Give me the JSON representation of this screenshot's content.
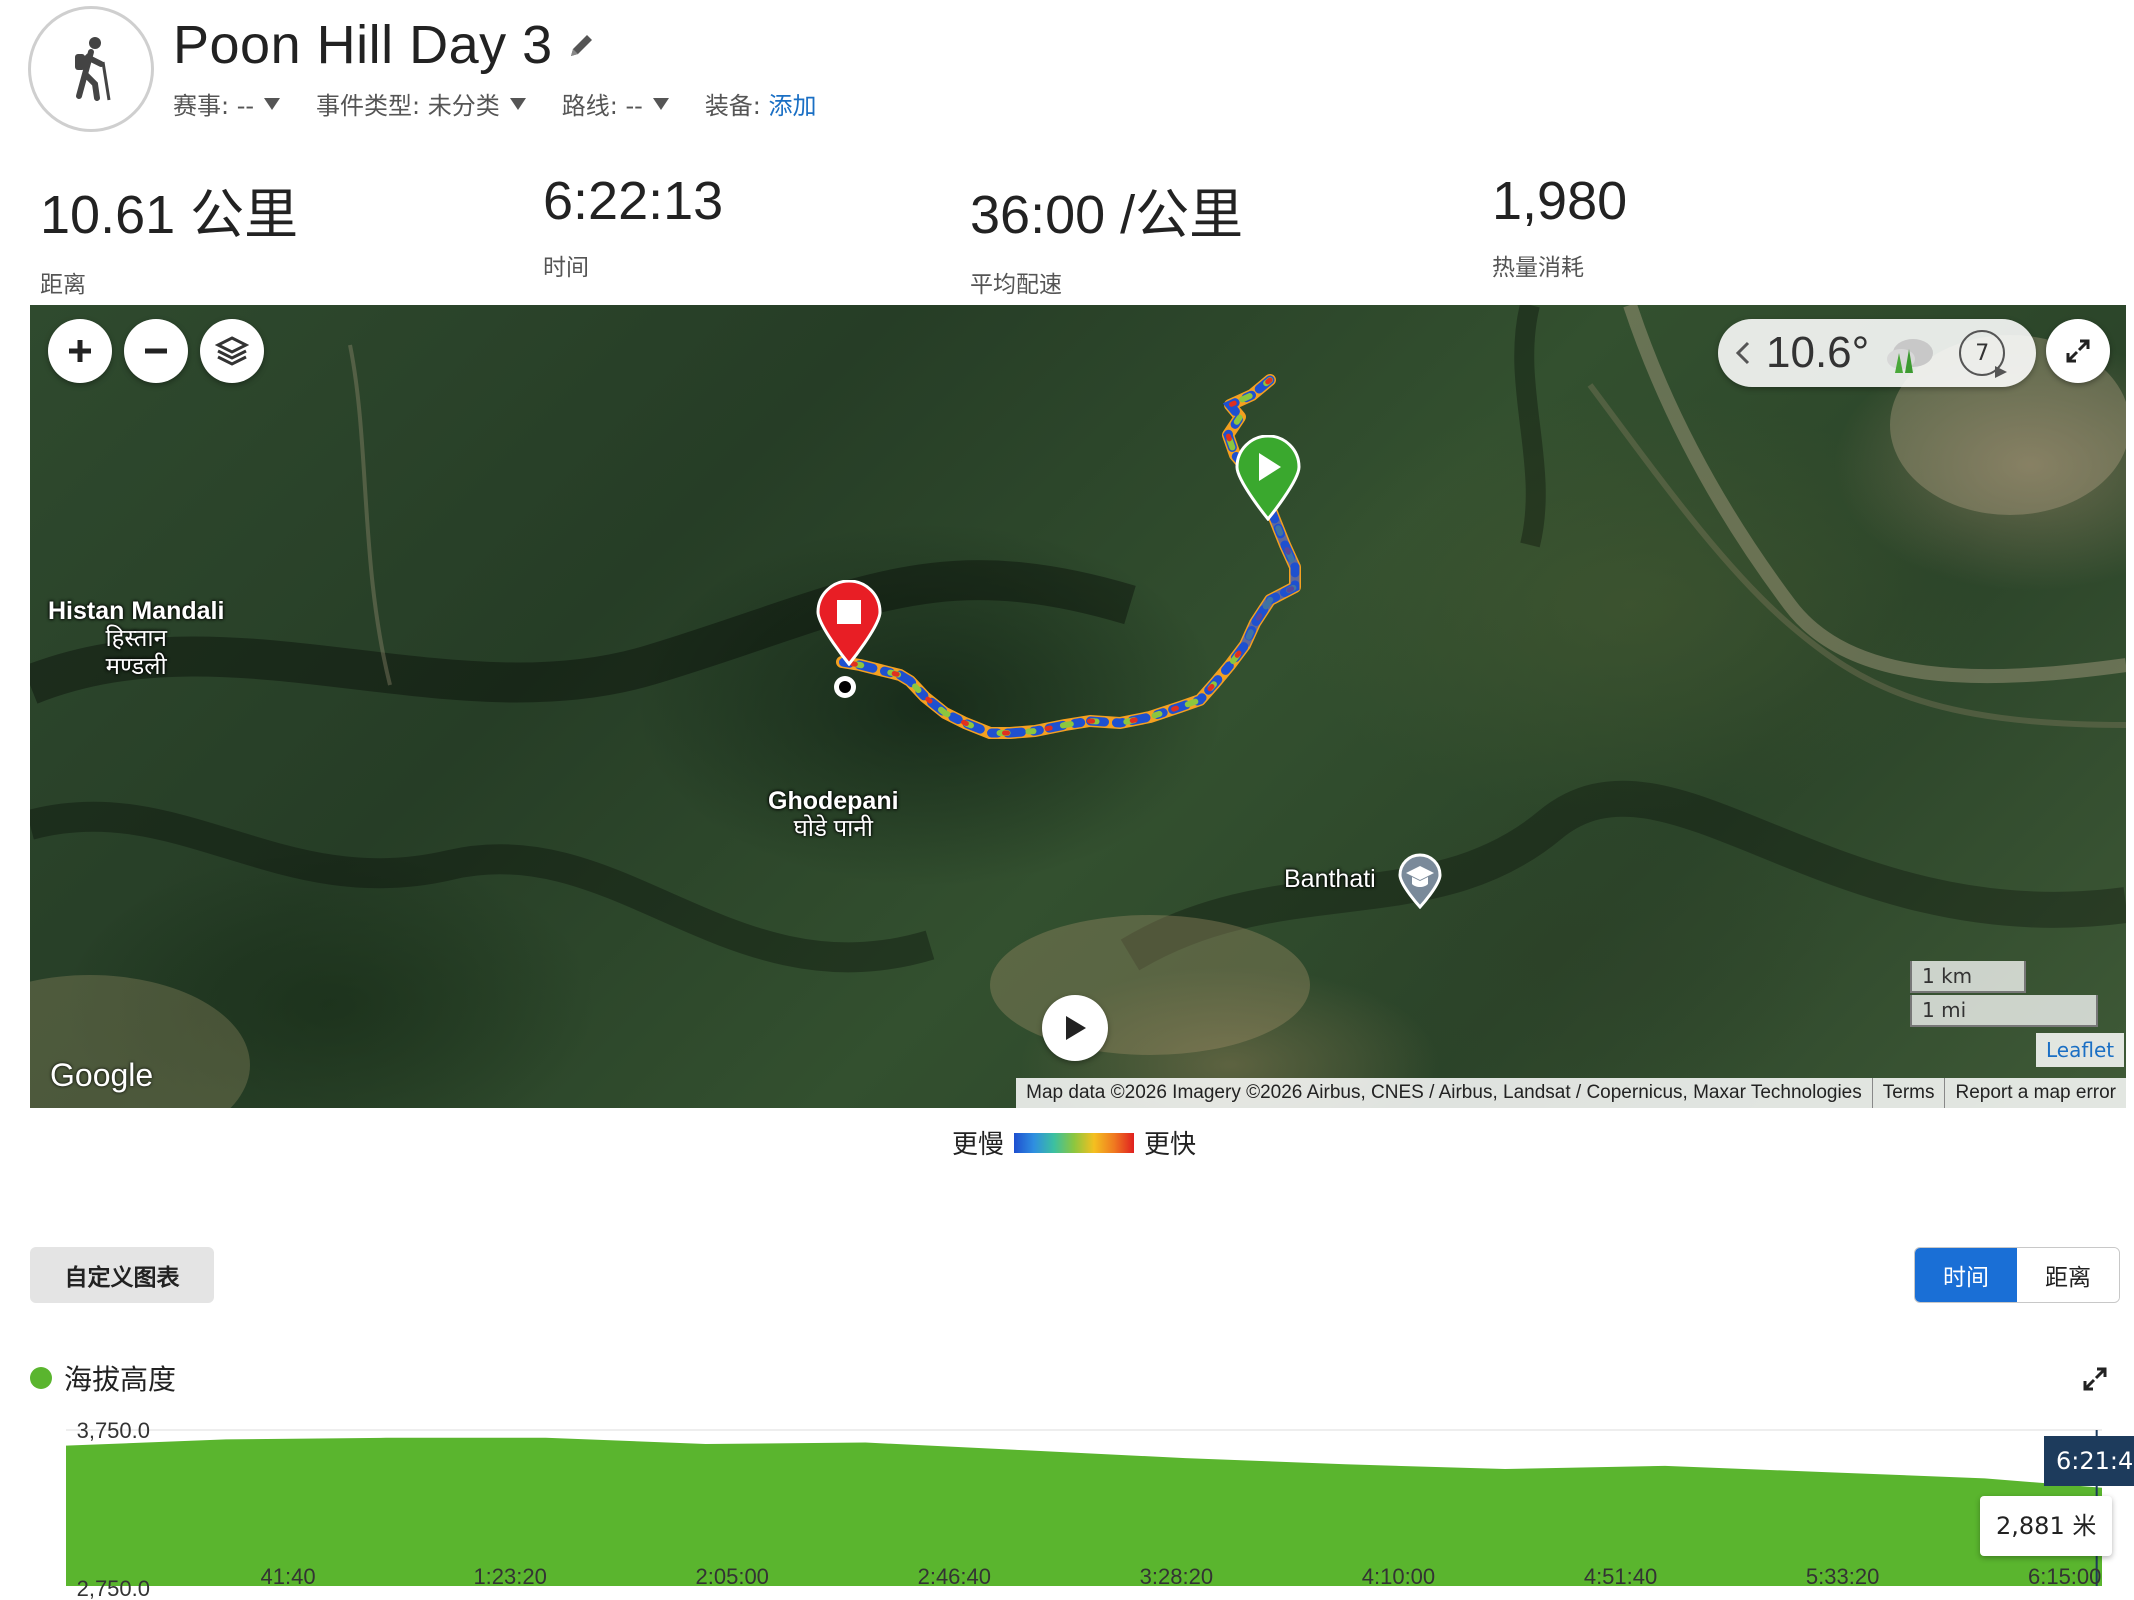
{
  "activity": {
    "title": "Poon Hill Day 3",
    "meta": [
      {
        "label": "赛事: --"
      },
      {
        "label": "事件类型: 未分类"
      },
      {
        "label": "路线: --"
      }
    ],
    "gear_label": "装备:",
    "gear_link": "添加"
  },
  "stats": [
    {
      "value": "10.61 公里",
      "label": "距离"
    },
    {
      "value": "6:22:13",
      "label": "时间"
    },
    {
      "value": "36:00 /公里",
      "label": "平均配速"
    },
    {
      "value": "1,980",
      "label": "热量消耗"
    }
  ],
  "map": {
    "weather_temp": "10.6°",
    "weather_wind": "7",
    "places": {
      "histan": {
        "name": "Histan Mandali",
        "native1": "हिस्तान",
        "native2": "मण्डली"
      },
      "ghode": {
        "name": "Ghodepani",
        "native": "घोडे पानी"
      },
      "banthati": {
        "name": "Banthati"
      }
    },
    "scale_km": "1 km",
    "scale_mi": "1 mi",
    "leaflet": "Leaflet",
    "attribution": "Map data ©2026 Imagery ©2026 Airbus, CNES / Airbus, Landsat / Copernicus, Maxar Technologies",
    "terms": "Terms",
    "report": "Report a map error",
    "google": "Google",
    "icons": [
      "zoom-in-icon",
      "zoom-out-icon",
      "layers-icon",
      "chevron-left-icon",
      "cloud-icon",
      "wind-icon",
      "fullscreen-icon",
      "play-icon"
    ]
  },
  "legend": {
    "slow": "更慢",
    "fast": "更快"
  },
  "chart_controls": {
    "custom_button": "自定义图表",
    "toggle_time": "时间",
    "toggle_distance": "距离"
  },
  "series_legend": {
    "label": "海拔高度",
    "color": "#5ab52e"
  },
  "tooltip": {
    "time": "6:21:4",
    "value": "2,881 米"
  },
  "chart_data": {
    "type": "area",
    "ylabel": "",
    "ylim": [
      2750,
      3750
    ],
    "y_tick_labels": [
      "3,750.0",
      "2,750.0"
    ],
    "x_tick_labels": [
      "41:40",
      "1:23:20",
      "2:05:00",
      "2:46:40",
      "3:28:20",
      "4:10:00",
      "4:51:40",
      "5:33:20",
      "6:15:00"
    ],
    "x_minutes": [
      0,
      30,
      60,
      90,
      120,
      150,
      180,
      210,
      240,
      270,
      300,
      330,
      360,
      382
    ],
    "series": [
      {
        "values": [
          3650,
          3690,
          3700,
          3700,
          3660,
          3670,
          3620,
          3570,
          3530,
          3500,
          3520,
          3480,
          3440,
          3380
        ]
      }
    ],
    "grid": false
  }
}
